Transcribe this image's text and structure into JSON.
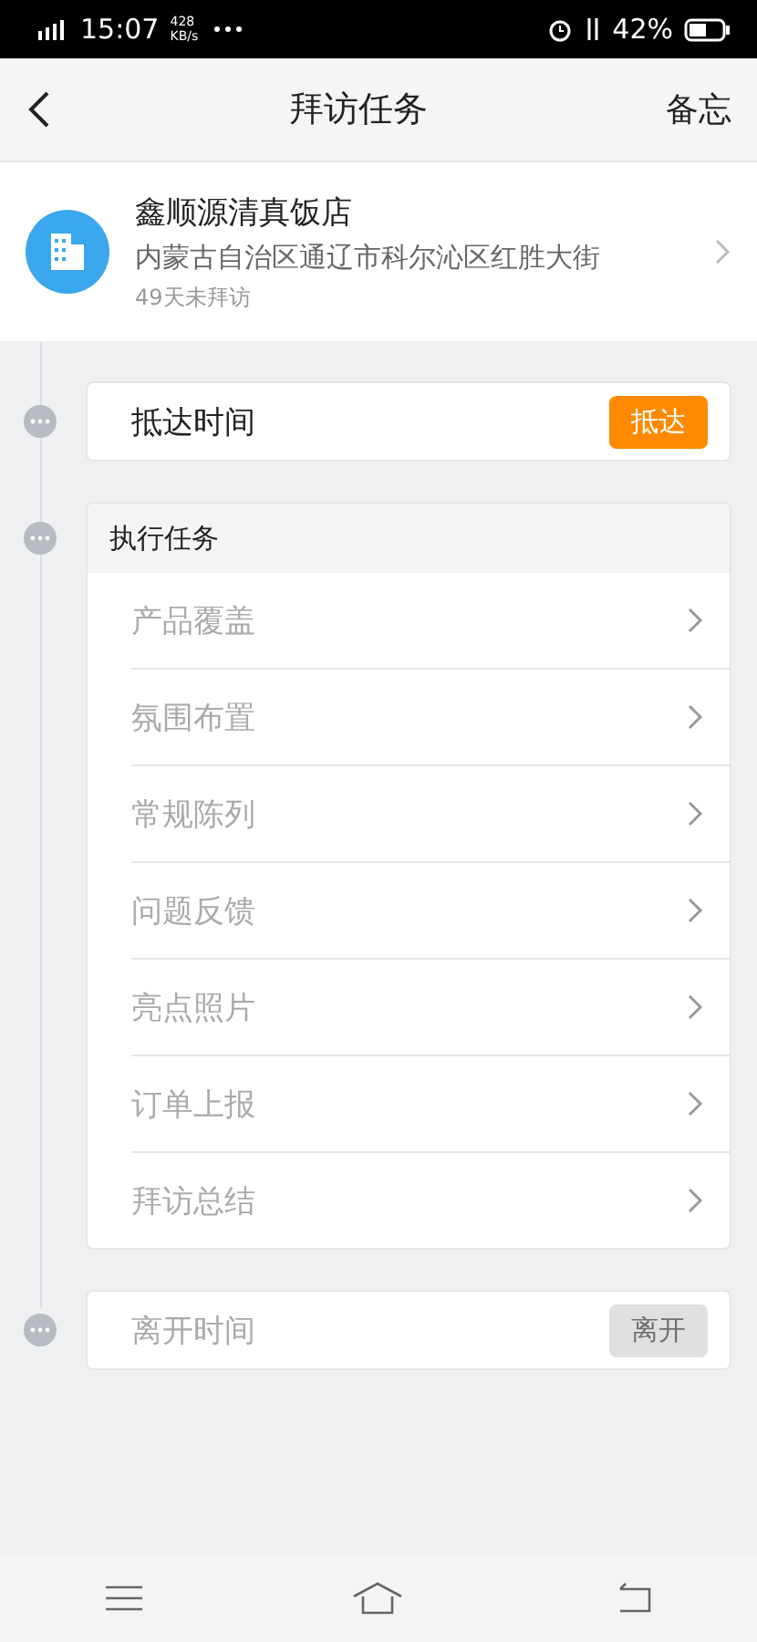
{
  "status_bar": {
    "time": "15:07",
    "speed": "428 KB/s",
    "battery": "42%"
  },
  "header": {
    "title": "拜访任务",
    "action": "备忘"
  },
  "store": {
    "name": "鑫顺源清真饭店",
    "address": "内蒙古自治区通辽市科尔沁区红胜大街",
    "last_visit": "49天未拜访"
  },
  "arrive": {
    "label": "抵达时间",
    "button": "抵达",
    "disabled": false
  },
  "tasks": {
    "title": "执行任务",
    "items": [
      {
        "label": "产品覆盖",
        "disabled": true
      },
      {
        "label": "氛围布置",
        "disabled": true
      },
      {
        "label": "常规陈列",
        "disabled": true
      },
      {
        "label": "问题反馈",
        "disabled": true
      },
      {
        "label": "亮点照片",
        "disabled": true
      },
      {
        "label": "订单上报",
        "disabled": true
      },
      {
        "label": "拜访总结",
        "disabled": true
      }
    ]
  },
  "leave": {
    "label": "离开时间",
    "button": "离开",
    "disabled": true
  }
}
